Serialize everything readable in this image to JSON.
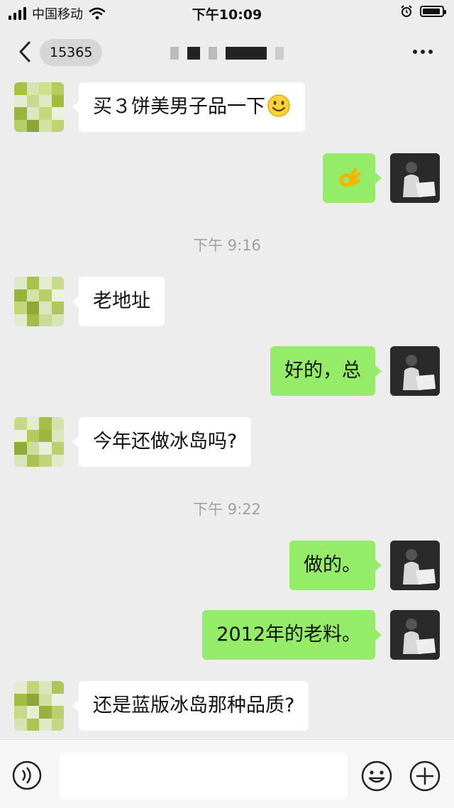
{
  "status_bar": {
    "carrier": "中国移动",
    "time": "下午10:09"
  },
  "nav": {
    "unread_count": "15365"
  },
  "messages": [
    {
      "side": "left",
      "text": "买３饼美男子品一下",
      "emoji": "smile-emoji"
    },
    {
      "side": "right",
      "text": "",
      "emoji": "ok-hand-emoji"
    },
    {
      "type": "time",
      "text": "下午 9:16"
    },
    {
      "side": "left",
      "text": "老地址"
    },
    {
      "side": "right",
      "text": "好的，总"
    },
    {
      "side": "left",
      "text": "今年还做冰岛吗?"
    },
    {
      "type": "time",
      "text": "下午 9:22"
    },
    {
      "side": "right",
      "text": "做的。"
    },
    {
      "side": "right",
      "text": "2012年的老料。"
    },
    {
      "side": "left",
      "text": "还是蓝版冰岛那种品质?"
    }
  ],
  "colors": {
    "background": "#ededed",
    "sent_bubble": "#95ec69",
    "received_bubble": "#ffffff",
    "timestamp_text": "#a0a0a0"
  },
  "icons": {
    "back": "chevron-left-icon",
    "more": "more-dots-icon",
    "voice": "voice-icon",
    "emoji": "emoji-icon",
    "plus": "plus-icon"
  }
}
